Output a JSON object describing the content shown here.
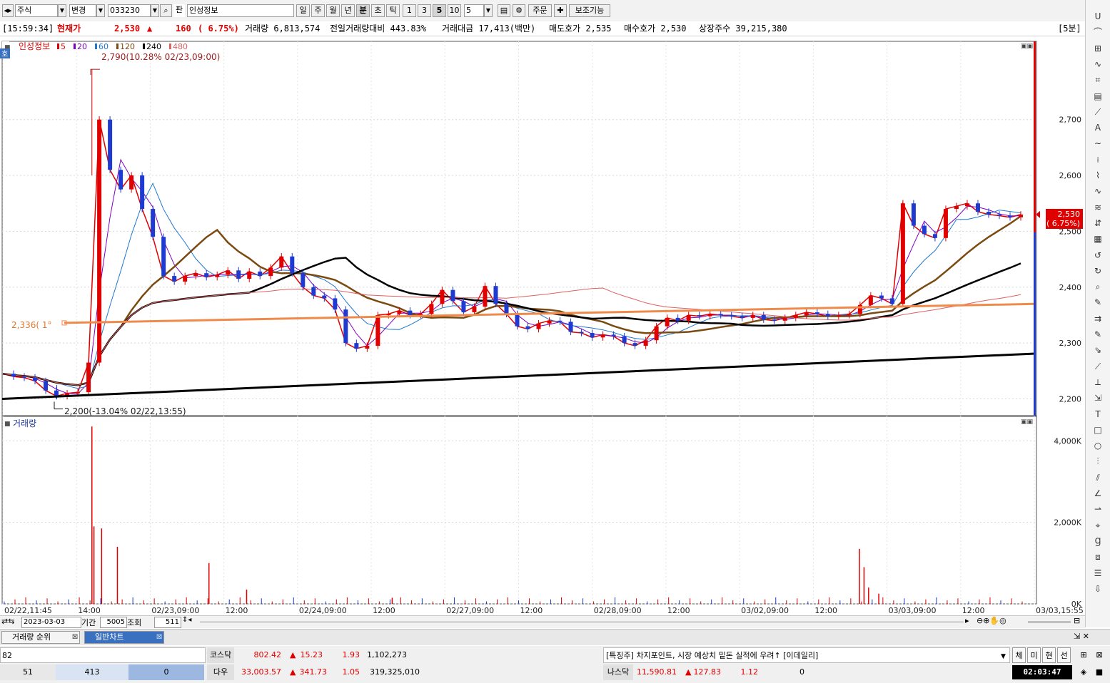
{
  "toolbar": {
    "market": "주식",
    "change_label": "변경",
    "code": "033230",
    "pan_label": "판",
    "stock_name": "인성정보",
    "periods": [
      "일",
      "주",
      "월",
      "년",
      "분",
      "초",
      "틱"
    ],
    "selected_period": "분",
    "intervals": [
      "1",
      "3",
      "5",
      "10"
    ],
    "selected_interval": "5",
    "interval_value": "5",
    "order_label": "주문",
    "aux_label": "보조기능"
  },
  "info": {
    "time": "[15:59:34]",
    "price_label": "현재가",
    "price": "2,530",
    "change_arrow": "▲",
    "change": "160",
    "change_pct": "( 6.75%)",
    "volume": "거래량 6,813,574",
    "prev_ratio": "전일거래량대비 443.83%",
    "amount": "거래대금 17,413(백만)",
    "ask": "매도호가 2,535",
    "bid": "매수호가 2,530",
    "listed": "상장주수 39,215,380",
    "interval_tag": "[5분]"
  },
  "legend": {
    "name": "인성정보",
    "ma": [
      {
        "label": "5",
        "color": "#e00000"
      },
      {
        "label": "20",
        "color": "#8000c0"
      },
      {
        "label": "60",
        "color": "#1e78d0"
      },
      {
        "label": "120",
        "color": "#7a4a10"
      },
      {
        "label": "240",
        "color": "#000000"
      },
      {
        "label": "480",
        "color": "#e06060"
      }
    ],
    "side_tag": "호"
  },
  "chart_data": {
    "type": "candlestick",
    "high_label": "2,790(10.28% 02/23,09:00)",
    "low_label": "2,200(-13.04% 02/22,13:55)",
    "line_label": "2,336(  1°",
    "price_ticks": [
      "2,700",
      "2,600",
      "2,500",
      "2,400",
      "2,300",
      "2,200"
    ],
    "price_tick_values": [
      2700,
      2600,
      2500,
      2400,
      2300,
      2200
    ],
    "ylim": [
      2170,
      2840
    ],
    "current_price": "2,530",
    "current_pct": "( 6.75%)",
    "current_value": 2530,
    "volume_title": "거래량",
    "volume_ticks": [
      "4,000K",
      "2,000K",
      "0K"
    ],
    "volume_tick_values": [
      4000,
      2000,
      0
    ],
    "volume_ylim": [
      0,
      4600
    ],
    "x_labels": [
      "02/22,11:45",
      "14:00",
      "02/23,09:00",
      "12:00",
      "02/24,09:00",
      "12:00",
      "02/27,09:00",
      "12:00",
      "02/28,09:00",
      "12:00",
      "03/02,09:00",
      "12:00",
      "03/03,09:00",
      "12:00",
      "03/03,15:55"
    ],
    "price_path": [
      2245,
      2240,
      2238,
      2232,
      2215,
      2205,
      2210,
      2212,
      2265,
      2700,
      2610,
      2575,
      2600,
      2540,
      2490,
      2420,
      2410,
      2420,
      2425,
      2418,
      2422,
      2430,
      2415,
      2428,
      2420,
      2435,
      2455,
      2425,
      2400,
      2385,
      2380,
      2360,
      2300,
      2290,
      2295,
      2350,
      2352,
      2358,
      2350,
      2352,
      2370,
      2395,
      2375,
      2355,
      2365,
      2402,
      2370,
      2352,
      2330,
      2325,
      2335,
      2340,
      2338,
      2320,
      2318,
      2310,
      2315,
      2312,
      2300,
      2295,
      2305,
      2330,
      2345,
      2340,
      2350,
      2348,
      2352,
      2350,
      2348,
      2345,
      2350,
      2342,
      2340,
      2345,
      2350,
      2355,
      2352,
      2348,
      2350,
      2352,
      2368,
      2385,
      2380,
      2370,
      2550,
      2510,
      2495,
      2488,
      2540,
      2545,
      2550,
      2535,
      2530,
      2528,
      2525,
      2530
    ],
    "volume_bars": [
      {
        "x": 0.0875,
        "v": 4350
      },
      {
        "x": 0.0895,
        "v": 1900
      },
      {
        "x": 0.097,
        "v": 1850
      },
      {
        "x": 0.1125,
        "v": 1400
      },
      {
        "x": 0.2025,
        "v": 1000
      },
      {
        "x": 0.2395,
        "v": 350
      },
      {
        "x": 0.3825,
        "v": 150
      },
      {
        "x": 0.8415,
        "v": 1350
      },
      {
        "x": 0.846,
        "v": 900
      },
      {
        "x": 0.8505,
        "v": 400
      },
      {
        "x": 0.8605,
        "v": 250
      }
    ]
  },
  "tabs": [
    {
      "label": "거래량 순위"
    },
    {
      "label": "일반차트"
    }
  ],
  "bottom_bar": {
    "date": "2023-03-03",
    "period_label": "기간",
    "period_value": "5005",
    "query_label": "조회",
    "count": "511"
  },
  "ticker": {
    "left_value": "82",
    "row2_a": "51",
    "row2_b": "413",
    "row2_c": "0",
    "kosdaq": {
      "name": "코스닥",
      "value": "802.42",
      "arrow": "▲",
      "change": "15.23",
      "pct": "1.93",
      "vol": "1,102,273"
    },
    "dow": {
      "name": "다우",
      "value": "33,003.57",
      "arrow": "▲",
      "change": "341.73",
      "pct": "1.05",
      "vol": "319,325,010"
    },
    "nasdaq": {
      "name": "나스닥",
      "value": "11,590.81",
      "arrow": "▲",
      "change": "127.83",
      "pct": "1.12",
      "vol": "0"
    },
    "news": "[특징주] 차지포인트, 시장 예상치 밑돈 실적에 우려↑ [이데일리]",
    "buttons": [
      "체",
      "미",
      "현",
      "선"
    ],
    "clock": "02:03:47"
  }
}
